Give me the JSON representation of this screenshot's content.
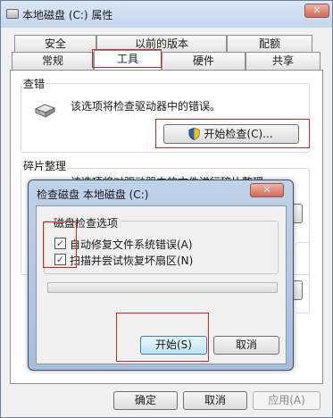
{
  "window": {
    "title": "本地磁盘 (C:) 属性",
    "close_symbol": "✕"
  },
  "tabs": {
    "row1": [
      "安全",
      "以前的版本",
      "配额"
    ],
    "row2": [
      "常规",
      "工具",
      "硬件",
      "共享"
    ],
    "active": "工具"
  },
  "error_check": {
    "group_label": "查错",
    "description": "该选项将检查驱动器中的错误。",
    "button_label": "开始检查(C)..."
  },
  "defrag": {
    "group_label": "碎片整理",
    "description_partial": "该选项将对驱动器中的文件进行碎片整理。"
  },
  "footer": {
    "ok": "确定",
    "cancel": "取消",
    "apply": "应用(A)"
  },
  "dialog": {
    "title": "检查磁盘 本地磁盘 (C:)",
    "close_symbol": "✕",
    "options_label": "磁盘检查选项",
    "options": [
      {
        "label": "自动修复文件系统错误(A)",
        "checked": true
      },
      {
        "label": "扫描并尝试恢复坏扇区(N)",
        "checked": true
      }
    ],
    "progress": 0,
    "start_button": "开始(S)",
    "cancel_button": "取消"
  },
  "icons": {
    "drive": "hard-drive-icon",
    "shield": "uac-shield-icon",
    "check": "✓"
  },
  "colors": {
    "highlight": "#d8232a",
    "dialog_frame": "#a6bedb",
    "title_bar": "#c3d6ec"
  }
}
